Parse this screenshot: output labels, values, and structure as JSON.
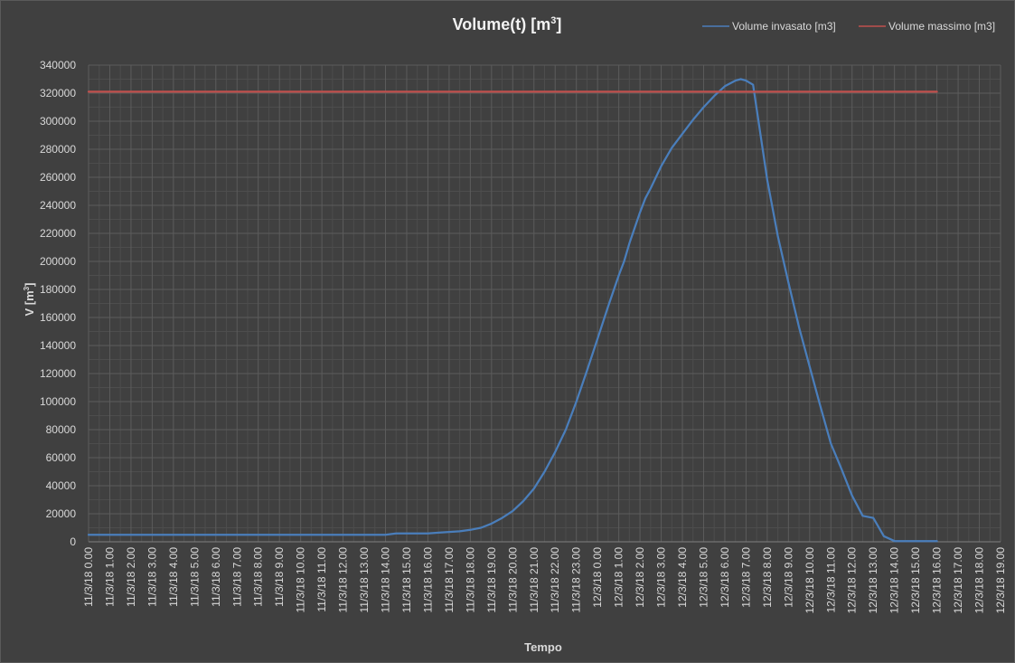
{
  "chart_data": {
    "type": "line",
    "title": "Volume(t)  [m",
    "title_sup": "3",
    "title_suffix": "]",
    "ylabel": "V [m",
    "ylabel_sup": "3",
    "ylabel_suffix": "]",
    "xlabel": "Tempo",
    "ylim": [
      0,
      340000
    ],
    "y_ticks": [
      0,
      20000,
      40000,
      60000,
      80000,
      100000,
      120000,
      140000,
      160000,
      180000,
      200000,
      220000,
      240000,
      260000,
      280000,
      300000,
      320000,
      340000
    ],
    "x_ticks": [
      "11/3/18  0.00",
      "11/3/18  1.00",
      "11/3/18  2.00",
      "11/3/18  3.00",
      "11/3/18  4.00",
      "11/3/18  5.00",
      "11/3/18  6.00",
      "11/3/18  7.00",
      "11/3/18  8.00",
      "11/3/18  9.00",
      "11/3/18  10.00",
      "11/3/18  11.00",
      "11/3/18  12.00",
      "11/3/18  13.00",
      "11/3/18  14.00",
      "11/3/18  15.00",
      "11/3/18  16.00",
      "11/3/18  17.00",
      "11/3/18  18.00",
      "11/3/18  19.00",
      "11/3/18  20.00",
      "11/3/18  21.00",
      "11/3/18  22.00",
      "11/3/18  23.00",
      "12/3/18  0.00",
      "12/3/18  1.00",
      "12/3/18  2.00",
      "12/3/18  3.00",
      "12/3/18  4.00",
      "12/3/18  5.00",
      "12/3/18  6.00",
      "12/3/18  7.00",
      "12/3/18  8.00",
      "12/3/18  9.00",
      "12/3/18  10.00",
      "12/3/18  11.00",
      "12/3/18  12.00",
      "12/3/18  13.00",
      "12/3/18  14.00",
      "12/3/18  15.00",
      "12/3/18  16.00",
      "12/3/18  17.00",
      "12/3/18  18.00",
      "12/3/18  19.00"
    ],
    "grid": true,
    "legend_position": "top-right",
    "series": [
      {
        "name": "Volume invasato [m3]",
        "color": "#4a7ebb",
        "x": [
          "11/3/18 0.00",
          "11/3/18 1.00",
          "11/3/18 2.00",
          "11/3/18 3.00",
          "11/3/18 4.00",
          "11/3/18 5.00",
          "11/3/18 6.00",
          "11/3/18 7.00",
          "11/3/18 8.00",
          "11/3/18 9.00",
          "11/3/18 10.00",
          "11/3/18 11.00",
          "11/3/18 12.00",
          "11/3/18 13.00",
          "11/3/18 14.00",
          "11/3/18 14.30",
          "11/3/18 15.00",
          "11/3/18 16.00",
          "11/3/18 16.30",
          "11/3/18 17.00",
          "11/3/18 17.30",
          "11/3/18 18.00",
          "11/3/18 18.30",
          "11/3/18 19.00",
          "11/3/18 19.30",
          "11/3/18 20.00",
          "11/3/18 20.30",
          "11/3/18 21.00",
          "11/3/18 21.30",
          "11/3/18 22.00",
          "11/3/18 22.30",
          "11/3/18 23.00",
          "11/3/18 23.30",
          "12/3/18 0.00",
          "12/3/18 0.30",
          "12/3/18 1.00",
          "12/3/18 1.15",
          "12/3/18 1.30",
          "12/3/18 2.00",
          "12/3/18 2.15",
          "12/3/18 2.30",
          "12/3/18 3.00",
          "12/3/18 3.30",
          "12/3/18 4.00",
          "12/3/18 4.30",
          "12/3/18 5.00",
          "12/3/18 5.30",
          "12/3/18 6.00",
          "12/3/18 6.30",
          "12/3/18 6.45",
          "12/3/18 7.00",
          "12/3/18 7.20",
          "12/3/18 8.00",
          "12/3/18 8.30",
          "12/3/18 9.00",
          "12/3/18 9.30",
          "12/3/18 10.00",
          "12/3/18 10.30",
          "12/3/18 11.00",
          "12/3/18 11.30",
          "12/3/18 12.00",
          "12/3/18 12.30",
          "12/3/18 13.00",
          "12/3/18 13.30",
          "12/3/18 14.00",
          "12/3/18 14.30",
          "12/3/18 15.00",
          "12/3/18 16.00"
        ],
        "values": [
          5000,
          5000,
          5000,
          5000,
          5000,
          5000,
          5000,
          5000,
          5000,
          5000,
          5000,
          5000,
          5000,
          5000,
          5000,
          6000,
          6000,
          6000,
          6500,
          7000,
          7500,
          8500,
          10000,
          13000,
          17000,
          22000,
          29000,
          38000,
          50000,
          64000,
          80000,
          100000,
          122000,
          145000,
          168000,
          190000,
          200000,
          213000,
          235000,
          245000,
          252000,
          268000,
          281000,
          291000,
          301000,
          310000,
          318000,
          325000,
          329000,
          330000,
          329000,
          326000,
          258000,
          218000,
          185000,
          153000,
          125000,
          97000,
          70000,
          52000,
          33000,
          18500,
          17000,
          4000,
          500,
          500,
          500,
          500
        ]
      },
      {
        "name": "Volume massimo [m3]",
        "color": "#c0504d",
        "x": [
          "11/3/18 0.00",
          "12/3/18 16.00"
        ],
        "values": [
          321000,
          321000
        ]
      }
    ]
  }
}
